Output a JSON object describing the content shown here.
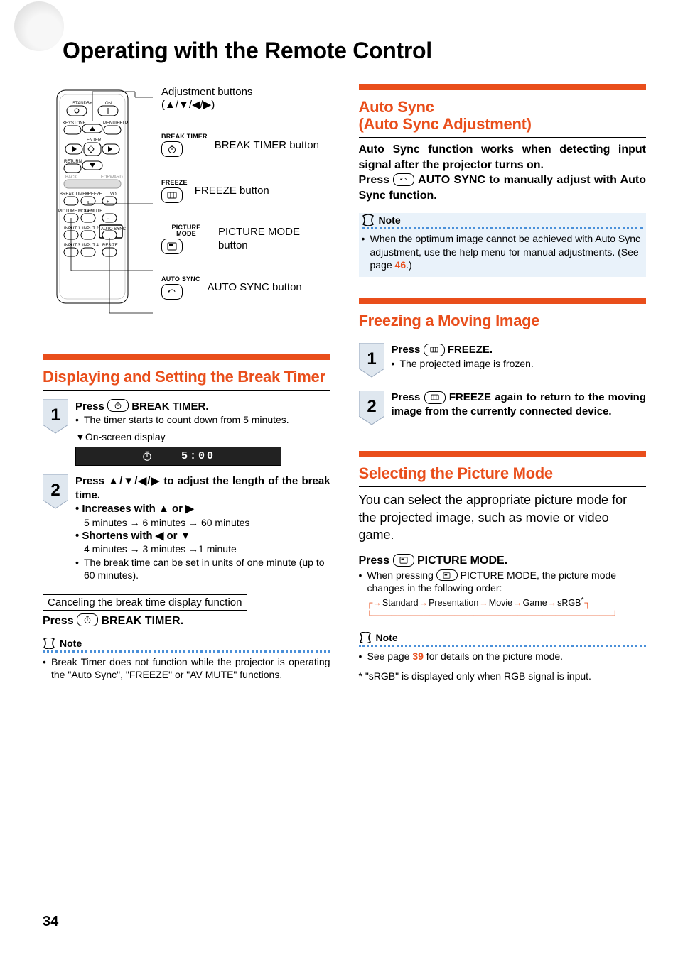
{
  "page_number": "34",
  "title": "Operating with the Remote Control",
  "remote_callouts": {
    "adjust": {
      "label": "Adjustment buttons",
      "sub": "(▲/▼/◀/▶)"
    },
    "break": {
      "key_label": "BREAK TIMER",
      "text": "BREAK TIMER button"
    },
    "freeze": {
      "key_label": "FREEZE",
      "text": "FREEZE button"
    },
    "picture": {
      "key_label": "PICTURE MODE",
      "text": "PICTURE MODE button"
    },
    "autosync": {
      "key_label": "AUTO SYNC",
      "text": "AUTO SYNC button"
    }
  },
  "auto_sync": {
    "heading": "Auto Sync\n(Auto Sync Adjustment)",
    "p1": "Auto Sync function works when detecting input signal after the projector turns on.",
    "p2a": "Press ",
    "p2b": " AUTO SYNC to manually adjust with Auto Sync function.",
    "note_label": "Note",
    "note_text_a": "When the optimum image cannot be achieved with Auto Sync adjustment, use the help menu for manual adjustments. (See page ",
    "note_page": "46",
    "note_text_b": ".)"
  },
  "break_timer": {
    "heading": "Displaying and Setting the Break Timer",
    "step1": {
      "line1a": "Press ",
      "line1b": " BREAK TIMER.",
      "bullet": "The timer starts to count down from 5 minutes.",
      "onscreen_label": "▼On-screen display",
      "onscreen_value": "5:00"
    },
    "step2": {
      "line1": "Press ▲/▼/◀/▶ to adjust the length of the break time.",
      "b1_label": "Increases with ▲ or ▶",
      "b1_text": "5 minutes → 6 minutes → 60 minutes",
      "b2_label": "Shortens with ◀ or ▼",
      "b2_text": "4 minutes → 3 minutes →1 minute",
      "b3": "The break time can be set in units of one minute (up to 60 minutes)."
    },
    "cancel_box": "Canceling the break time display function",
    "cancel_a": "Press ",
    "cancel_b": " BREAK TIMER.",
    "note_label": "Note",
    "note_text": "Break Timer does not function while the projector is operating the \"Auto Sync\", \"FREEZE\" or \"AV MUTE\" functions."
  },
  "freeze": {
    "heading": "Freezing a Moving Image",
    "step1a": "Press ",
    "step1b": " FREEZE.",
    "step1_bullet": "The projected image is frozen.",
    "step2a": "Press ",
    "step2b": " FREEZE again to return to the moving image from the currently connected device."
  },
  "picture_mode": {
    "heading": "Selecting the Picture Mode",
    "intro": "You can select the appropriate picture mode for the projected image, such as movie or video game.",
    "press_a": "Press ",
    "press_b": " PICTURE MODE.",
    "bullet_a": "When pressing ",
    "bullet_b": " PICTURE MODE, the picture mode changes in the following order:",
    "flow": [
      "Standard",
      "Presentation",
      "Movie",
      "Game",
      "sRGB"
    ],
    "star_note": "* \"sRGB\" is displayed only when RGB signal is input.",
    "note_label": "Note",
    "note_text_a": "See page ",
    "note_page": "39",
    "note_text_b": " for details on the picture mode."
  }
}
